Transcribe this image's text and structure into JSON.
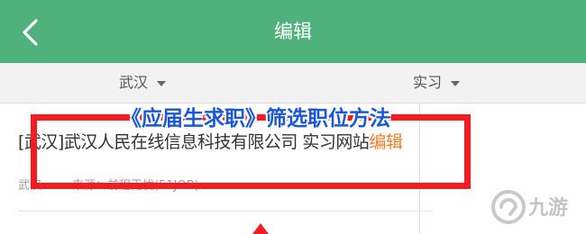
{
  "header": {
    "title": "编辑",
    "back_icon": "chevron-left-icon"
  },
  "filters": {
    "city": "武汉",
    "job_type": "实习",
    "dropdown_icon": "caret-down-icon"
  },
  "listing": {
    "title": "[武汉]武汉人民在线信息科技有限公司 实习网站",
    "edit_label": "编辑",
    "location": "武汉",
    "source": "来源：前程无忧(51JOB)"
  },
  "overlay": {
    "caption": "《应届生求职》筛选职位方法"
  },
  "watermark": {
    "text": "九游"
  },
  "colors": {
    "header_green": "#4fb17c",
    "highlight_red": "#f21c23",
    "caption_blue": "#1a58d8",
    "edit_orange": "#f07d2a"
  }
}
